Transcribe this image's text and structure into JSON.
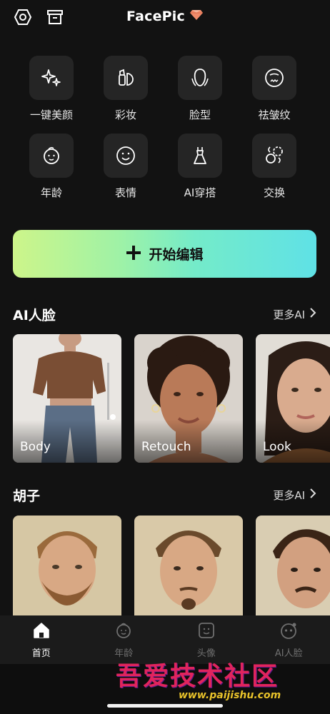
{
  "header": {
    "title": "FacePic"
  },
  "tools": [
    {
      "label": "一键美颜",
      "icon": "sparkles-icon"
    },
    {
      "label": "彩妆",
      "icon": "makeup-icon"
    },
    {
      "label": "脸型",
      "icon": "face-shape-icon"
    },
    {
      "label": "祛皱纹",
      "icon": "wrinkle-face-icon"
    },
    {
      "label": "年龄",
      "icon": "baby-face-icon"
    },
    {
      "label": "表情",
      "icon": "smile-face-icon"
    },
    {
      "label": "AI穿搭",
      "icon": "dress-icon"
    },
    {
      "label": "交换",
      "icon": "swap-face-icon"
    }
  ],
  "start": {
    "label": "开始编辑"
  },
  "sections": [
    {
      "title": "AI人脸",
      "more": "更多AI",
      "cards": [
        "Body",
        "Retouch",
        "Look"
      ]
    },
    {
      "title": "胡子",
      "more": "更多AI",
      "cards": [
        "",
        "",
        ""
      ]
    }
  ],
  "tabbar": [
    {
      "label": "首页",
      "icon": "home-icon",
      "active": true
    },
    {
      "label": "年龄",
      "icon": "age-icon",
      "active": false
    },
    {
      "label": "头像",
      "icon": "avatar-icon",
      "active": false
    },
    {
      "label": "AI人脸",
      "icon": "ai-face-icon",
      "active": false
    }
  ],
  "watermark": {
    "text": "吾爱技术社区",
    "url": "www.paijishu.com"
  },
  "colors": {
    "background": "#121212",
    "tile": "#252525",
    "accent_start": "#cdf58a",
    "accent_end": "#5fe1e6"
  }
}
